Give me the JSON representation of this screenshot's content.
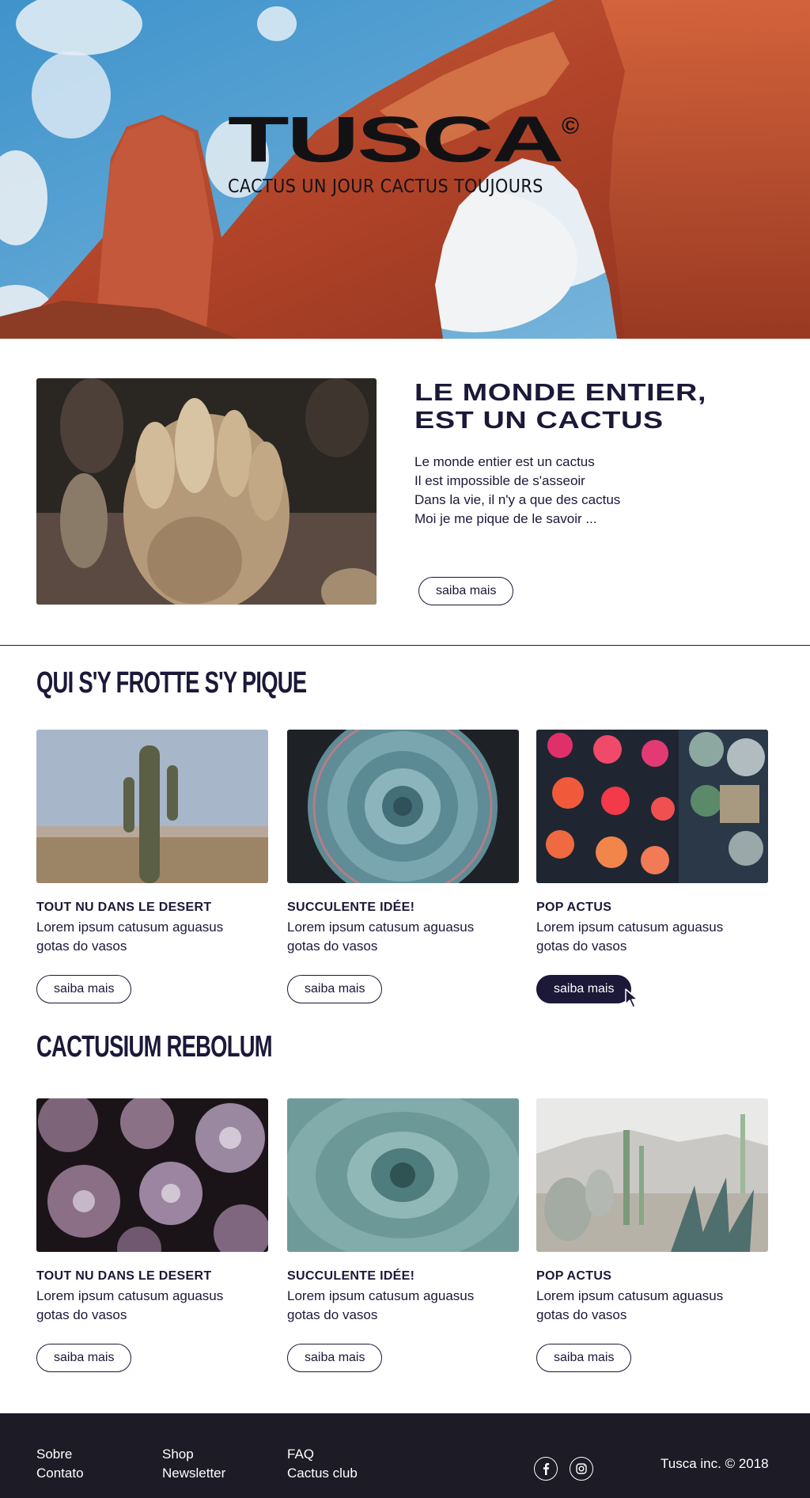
{
  "hero": {
    "logo": "TUSCA",
    "copyright_mark": "©",
    "tagline": "CACTUS UN JOUR CACTUS TOUJOURS"
  },
  "intro": {
    "title_line1": "LE MONDE ENTIER,",
    "title_line2": "EST UN CACTUS",
    "lines": [
      "Le monde entier est un cactus",
      "Il est impossible de s'asseoir",
      "Dans la vie, il n'y a que des cactus",
      "Moi je me pique de le savoir ..."
    ],
    "button": "saiba mais"
  },
  "section1": {
    "title": "QUI S'Y FROTTE S'Y PIQUE",
    "cards": [
      {
        "title": "TOUT NU DANS LE DESERT",
        "desc": "Lorem ipsum catusum aguasus gotas do vasos",
        "button": "saiba mais"
      },
      {
        "title": "SUCCULENTE IDÉE!",
        "desc": "Lorem ipsum catusum aguasus gotas do vasos",
        "button": "saiba mais"
      },
      {
        "title": "POP ACTUS",
        "desc": "Lorem ipsum catusum aguasus gotas do vasos",
        "button": "saiba mais"
      }
    ]
  },
  "section2": {
    "title": "CACTUSIUM REBOLUM",
    "cards": [
      {
        "title": "TOUT NU DANS LE DESERT",
        "desc": "Lorem ipsum catusum aguasus gotas do vasos",
        "button": "saiba mais"
      },
      {
        "title": "SUCCULENTE IDÉE!",
        "desc": "Lorem ipsum catusum aguasus gotas do vasos",
        "button": "saiba mais"
      },
      {
        "title": "POP ACTUS",
        "desc": "Lorem ipsum catusum aguasus gotas do vasos",
        "button": "saiba mais"
      }
    ]
  },
  "footer": {
    "col1": [
      "Sobre",
      "Contato"
    ],
    "col2": [
      "Shop",
      "Newsletter"
    ],
    "col3": [
      "FAQ",
      "Cactus club"
    ],
    "social": [
      "facebook-icon",
      "instagram-icon"
    ],
    "copyright": "Tusca inc. © 2018"
  },
  "colors": {
    "navy": "#1b1838",
    "footer_bg": "#1c1b26",
    "rock": "#b4492c",
    "sky": "#4a9fd0"
  }
}
